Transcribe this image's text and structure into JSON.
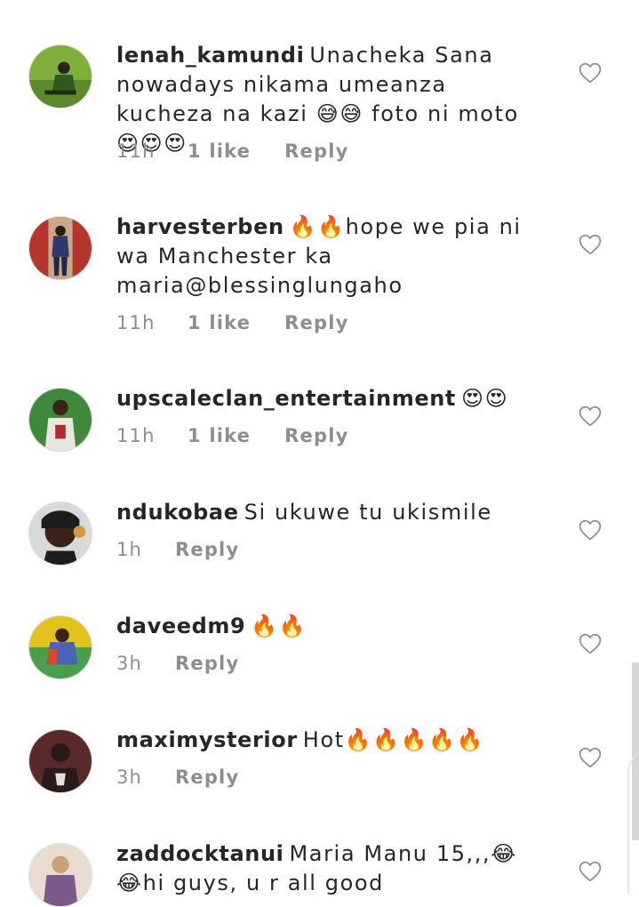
{
  "comments": [
    {
      "username": "lenah_kamundi",
      "text": "Unacheka Sana nowadays nikama umeanza kucheza na kazi 😅😅 foto ni moto😍😍😍",
      "time": "11h",
      "likes": "1 like",
      "reply": "Reply",
      "avatar_colors": [
        "#7fae3c",
        "#2f5a1e"
      ],
      "like_icon": "heart-outline-icon"
    },
    {
      "username": "harvesterben",
      "text": "🔥🔥hope we pia ni wa Manchester ka maria@blessinglungaho",
      "time": "11h",
      "likes": "1 like",
      "reply": "Reply",
      "avatar_colors": [
        "#b5342c",
        "#2c3a6b"
      ],
      "like_icon": "heart-outline-icon"
    },
    {
      "username": "upscaleclan_entertainment",
      "text": "😍😍",
      "time": "11h",
      "likes": "1 like",
      "reply": "Reply",
      "avatar_colors": [
        "#3e8a3a",
        "#e9e6e0"
      ],
      "like_icon": "heart-outline-icon"
    },
    {
      "username": "ndukobae",
      "text": "Si ukuwe tu ukismile",
      "time": "1h",
      "likes": "",
      "reply": "Reply",
      "avatar_colors": [
        "#1d1d1d",
        "#d49a3c"
      ],
      "like_icon": "heart-outline-icon"
    },
    {
      "username": "daveedm9",
      "text": "🔥🔥",
      "time": "3h",
      "likes": "",
      "reply": "Reply",
      "avatar_colors": [
        "#e2c21c",
        "#4a63b5"
      ],
      "like_icon": "heart-outline-icon"
    },
    {
      "username": "maximysterior",
      "text": "Hot🔥🔥🔥🔥🔥",
      "time": "3h",
      "likes": "",
      "reply": "Reply",
      "avatar_colors": [
        "#5a2a2a",
        "#2a1a1a"
      ],
      "like_icon": "heart-outline-icon"
    },
    {
      "username": "zaddocktanui",
      "text": "Maria Manu 15,,,😂😂hi guys, u r all good",
      "time": "",
      "likes": "",
      "reply": "",
      "avatar_colors": [
        "#c9a27a",
        "#7a5a8a"
      ],
      "like_icon": "heart-outline-icon"
    }
  ],
  "colors": {
    "text": "#262626",
    "meta": "#8e8e8e",
    "border": "#dbdbdb"
  }
}
